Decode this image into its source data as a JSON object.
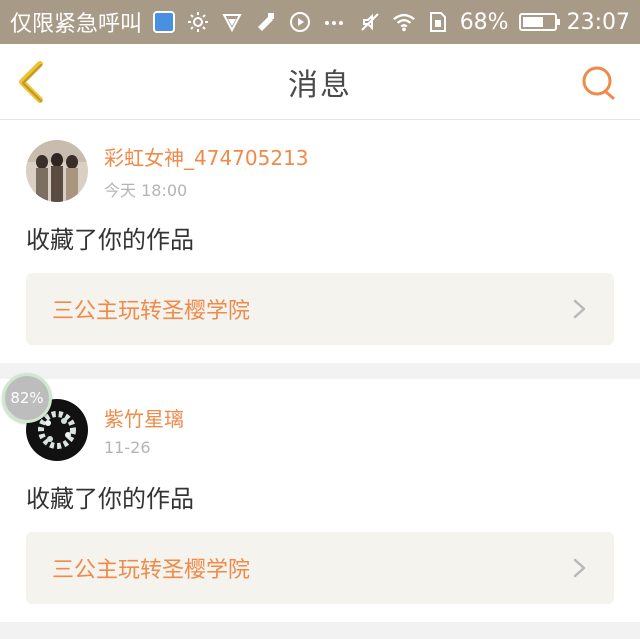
{
  "status_bar": {
    "carrier": "仅限紧急呼叫",
    "battery_percent": "68%",
    "battery_level": 0.68,
    "time": "23:07",
    "icons": [
      "shield-icon",
      "sun-icon",
      "vpn-icon",
      "tool-icon",
      "play-icon",
      "more-icon",
      "mute-icon",
      "wifi-icon",
      "sim-icon",
      "battery-icon"
    ]
  },
  "header": {
    "title": "消息",
    "back_icon": "chevron-left-icon",
    "search_icon": "search-icon"
  },
  "messages": [
    {
      "user": "彩虹女神_474705213",
      "time": "今天 18:00",
      "action": "收藏了你的作品",
      "work_title": "三公主玩转圣樱学院"
    },
    {
      "user": "紫竹星璃",
      "time": "11-26",
      "action": "收藏了你的作品",
      "work_title": "三公主玩转圣樱学院"
    }
  ],
  "floating_badge": "82%",
  "colors": {
    "accent": "#ef8b4a",
    "statusbar": "#a79a86",
    "back_icon": "#f2c12e",
    "work_bg": "#f5f3ee"
  }
}
